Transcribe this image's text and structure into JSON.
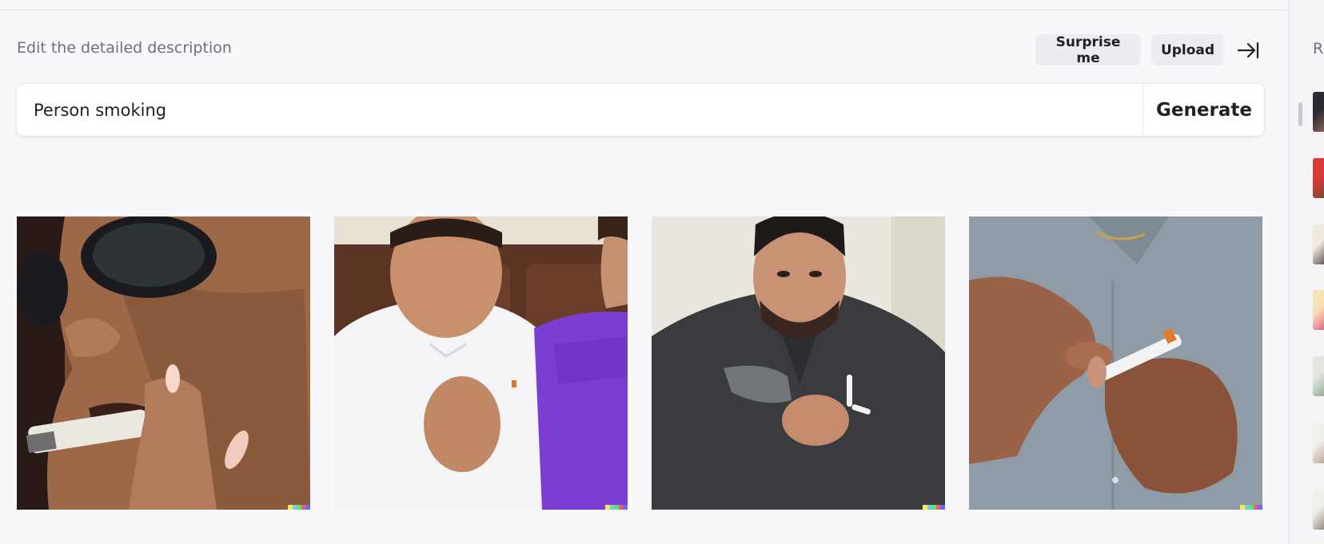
{
  "header": {
    "hint": "Edit the detailed description",
    "surprise_label": "Surprise me",
    "upload_label": "Upload",
    "collapse_icon": "arrow-right-to-bar-icon"
  },
  "prompt": {
    "value": "Person smoking",
    "generate_label": "Generate"
  },
  "results": [
    {
      "description": "close-up of a woman in sunglasses smoking a cigarette"
    },
    {
      "description": "man in white polo shirt holding a cigarette, person in purple shirt beside him"
    },
    {
      "description": "bearded man in dark shirt holding a cigarette with smoke"
    },
    {
      "description": "hands holding a cigarette in front of a grey shirt"
    }
  ],
  "badge_colors": [
    "#fce94f",
    "#6fd2e0",
    "#5fe07c",
    "#f0605d",
    "#6b6bf5"
  ],
  "right_panel": {
    "label": "R",
    "thumbnail_count": 7
  }
}
